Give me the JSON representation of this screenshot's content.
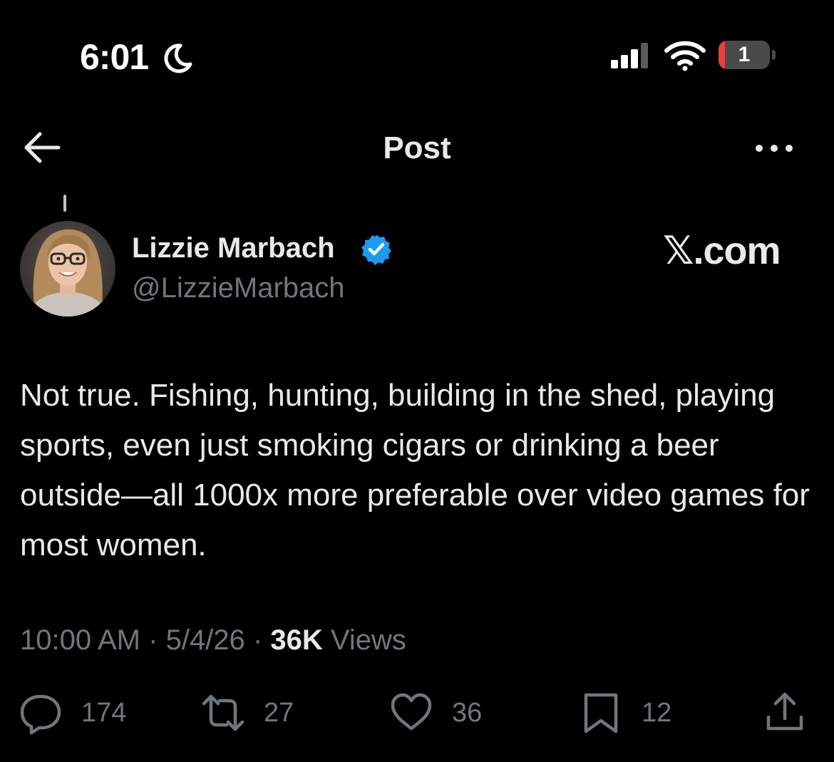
{
  "status_bar": {
    "time": "6:01",
    "battery_percent": "1",
    "battery_level": 0.12,
    "icons": [
      "moon-icon",
      "cellular-signal-icon",
      "wifi-icon",
      "battery-icon"
    ]
  },
  "header": {
    "title": "Post",
    "back_icon": "arrow-left-icon",
    "more_icon": "more-horizontal-icon"
  },
  "author": {
    "name": "Lizzie Marbach",
    "handle": "@LizzieMarbach",
    "verified": true
  },
  "watermark": "𝕏.com",
  "post": {
    "text": "Not true. Fishing, hunting, building in the shed, playing sports, even just smoking cigars or drinking a beer outside—all 1000x more preferable over video games for most women.",
    "time": "10:00 AM",
    "separator": "·",
    "date": "5/4/26",
    "views_count": "36K",
    "views_label": "Views"
  },
  "actions": {
    "replies": "174",
    "reposts": "27",
    "likes": "36",
    "bookmarks": "12"
  },
  "colors": {
    "background": "#000000",
    "text_primary": "#e7e9ea",
    "text_secondary": "#71767b",
    "verified_blue": "#1d9bf0",
    "battery_low": "#ea4036"
  }
}
